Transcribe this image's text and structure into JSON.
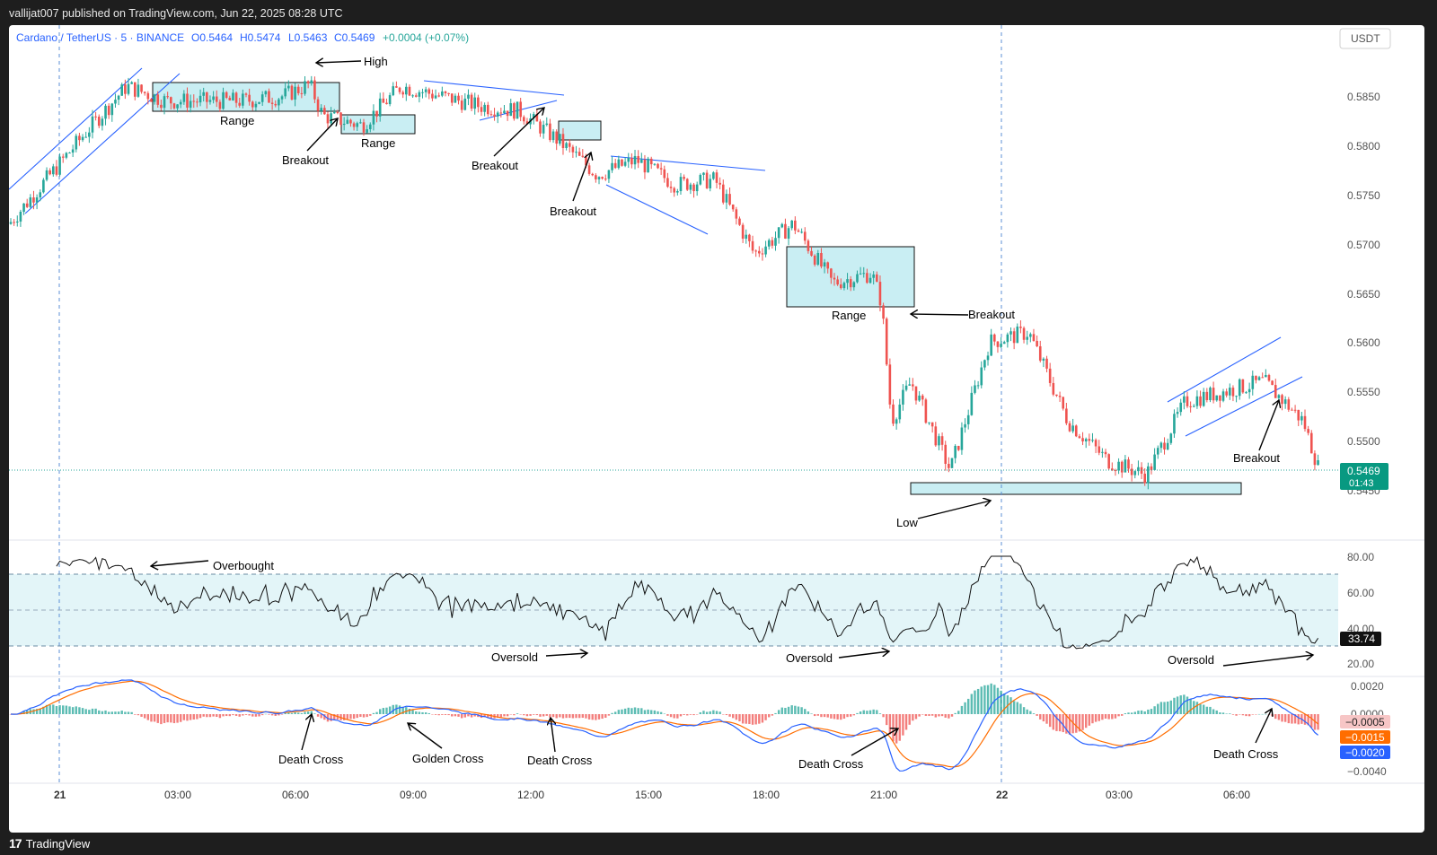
{
  "header": {
    "publisher_line": "vallijat007 published on TradingView.com, Jun 22, 2025 08:28 UTC"
  },
  "legend": {
    "symbol": "Cardano / TetherUS · 5 · BINANCE",
    "open": "O0.5464",
    "high": "H0.5474",
    "low": "L0.5463",
    "close": "C0.5469",
    "change": "+0.0004 (+0.07%)",
    "currency": "USDT"
  },
  "footer": {
    "logo_text": "TradingView"
  },
  "colors": {
    "up": "#26a69a",
    "down": "#ef5350",
    "accent_blue": "#2962ff",
    "zone_fill": "#c9eef3",
    "macd_signal": "#ff6d00",
    "macd_line": "#2962ff"
  },
  "price_axis": {
    "ticks": [
      "0.5850",
      "0.5800",
      "0.5750",
      "0.5700",
      "0.5650",
      "0.5600",
      "0.5550",
      "0.5500",
      "0.5450"
    ],
    "current_price": "0.5469",
    "countdown": "01:43"
  },
  "rsi_axis": {
    "ticks": [
      "80.00",
      "60.00",
      "40.00",
      "20.00"
    ],
    "current": "33.74"
  },
  "macd_axis": {
    "ticks": [
      "0.0020",
      "0.0000",
      "−0.0040"
    ],
    "hist_value": "−0.0005",
    "signal_value": "−0.0015",
    "macd_value": "−0.0020"
  },
  "time_axis": {
    "labels": [
      "21",
      "03:00",
      "06:00",
      "09:00",
      "12:00",
      "15:00",
      "18:00",
      "21:00",
      "22",
      "03:00",
      "06:00"
    ]
  },
  "annotations": [
    {
      "text": "High"
    },
    {
      "text": "Range"
    },
    {
      "text": "Range"
    },
    {
      "text": "Breakout"
    },
    {
      "text": "Breakout"
    },
    {
      "text": "Breakout"
    },
    {
      "text": "Range"
    },
    {
      "text": "Breakout"
    },
    {
      "text": "Low"
    },
    {
      "text": "Breakout"
    },
    {
      "text": "Overbought"
    },
    {
      "text": "Oversold"
    },
    {
      "text": "Oversold"
    },
    {
      "text": "Oversold"
    },
    {
      "text": "Death Cross"
    },
    {
      "text": "Golden Cross"
    },
    {
      "text": "Death Cross"
    },
    {
      "text": "Death Cross"
    },
    {
      "text": "Death Cross"
    }
  ],
  "chart_data": [
    {
      "type": "candlestick",
      "symbol": "ADAUSDT",
      "interval": "5",
      "ylim": [
        0.544,
        0.588
      ],
      "last_close": 0.5469,
      "path_keypoints_time_price": [
        [
          "20 23:00",
          0.572
        ],
        [
          "21 01:00",
          0.5815
        ],
        [
          "21 02:00",
          0.586
        ],
        [
          "21 03:00",
          0.5845
        ],
        [
          "21 05:00",
          0.5845
        ],
        [
          "21 06:00",
          0.585
        ],
        [
          "21 06:40",
          0.5862
        ],
        [
          "21 07:00",
          0.583
        ],
        [
          "21 08:00",
          0.582
        ],
        [
          "21 09:00",
          0.586
        ],
        [
          "21 11:00",
          0.584
        ],
        [
          "21 12:00",
          0.5835
        ],
        [
          "21 13:00",
          0.5805
        ],
        [
          "21 14:00",
          0.577
        ],
        [
          "21 15:00",
          0.5785
        ],
        [
          "21 16:00",
          0.576
        ],
        [
          "21 17:00",
          0.5765
        ],
        [
          "21 18:00",
          0.569
        ],
        [
          "21 19:00",
          0.572
        ],
        [
          "21 20:00",
          0.566
        ],
        [
          "21 21:00",
          0.567
        ],
        [
          "21 21:15",
          0.564
        ],
        [
          "21 21:30",
          0.552
        ],
        [
          "21 22:00",
          0.556
        ],
        [
          "21 23:00",
          0.547
        ],
        [
          "22 00:00",
          0.56
        ],
        [
          "22 01:00",
          0.561
        ],
        [
          "22 02:00",
          0.552
        ],
        [
          "22 03:00",
          0.548
        ],
        [
          "22 04:00",
          0.5465
        ],
        [
          "22 05:00",
          0.554
        ],
        [
          "22 07:00",
          0.556
        ],
        [
          "22 08:00",
          0.552
        ],
        [
          "22 08:25",
          0.5469
        ]
      ]
    },
    {
      "type": "line",
      "name": "RSI",
      "ylim": [
        0,
        100
      ],
      "bands": [
        70,
        50,
        30
      ],
      "last_value": 33.74
    },
    {
      "type": "bar",
      "name": "MACD",
      "series_names": [
        "MACD",
        "Signal",
        "Histogram"
      ],
      "last_values": {
        "Histogram": -0.0005,
        "Signal": -0.0015,
        "MACD": -0.002
      }
    }
  ]
}
